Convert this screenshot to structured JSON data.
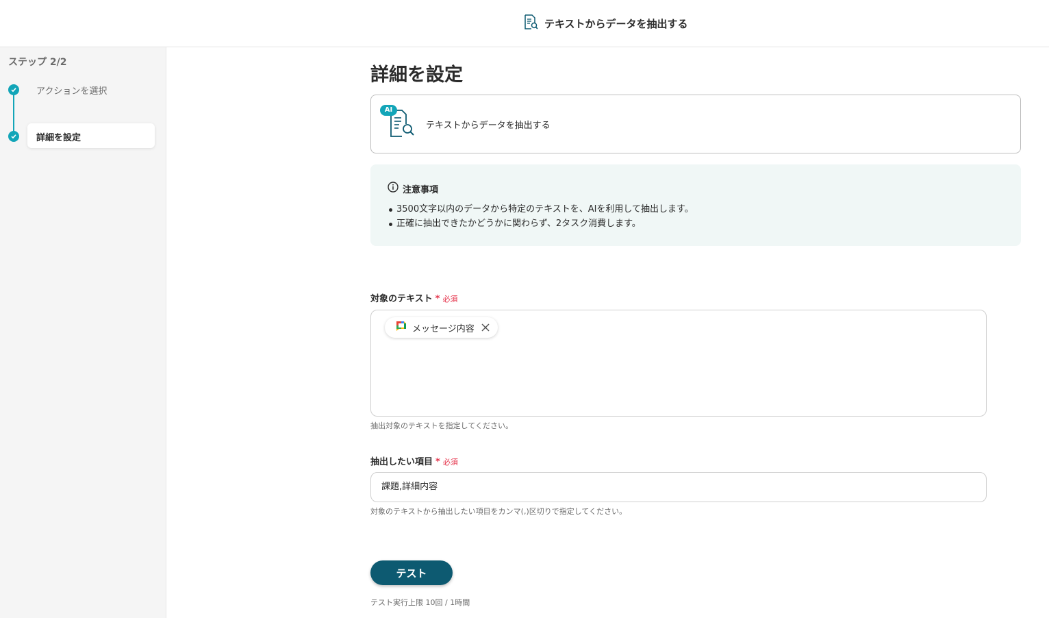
{
  "header": {
    "title": "テキストからデータを抽出する",
    "icon": "document-search-icon"
  },
  "sidebar": {
    "step_counter": "ステップ 2/2",
    "steps": [
      {
        "label": "アクションを選択",
        "state": "completed"
      },
      {
        "label": "詳細を設定",
        "state": "current"
      }
    ],
    "accent_color": "#12a5b8"
  },
  "main": {
    "title": "詳細を設定",
    "action_card": {
      "badge": "AI",
      "name": "テキストからデータを抽出する",
      "icon": "document-search-icon"
    },
    "notice": {
      "title": "注意事項",
      "items": [
        "3500文字以内のデータから特定のテキストを、AIを利用して抽出します。",
        "正確に抽出できたかどうかに関わらず、2タスク消費します。"
      ]
    },
    "fields": {
      "target_text": {
        "label": "対象のテキスト",
        "required_star": "*",
        "required_label": "必須",
        "chip_label": "メッセージ内容",
        "chip_icon": "google-chat-icon",
        "help": "抽出対象のテキストを指定してください。"
      },
      "extract_items": {
        "label": "抽出したい項目",
        "required_star": "*",
        "required_label": "必須",
        "value": "課題,詳細内容",
        "help": "対象のテキストから抽出したい項目をカンマ(,)区切りで指定してください。"
      }
    },
    "test_button": "テスト",
    "test_limit": "テスト実行上限 10回 / 1時間"
  },
  "colors": {
    "primary_button": "#0d5a71",
    "required": "#e5334b",
    "notice_bg": "#f0f7f6"
  }
}
